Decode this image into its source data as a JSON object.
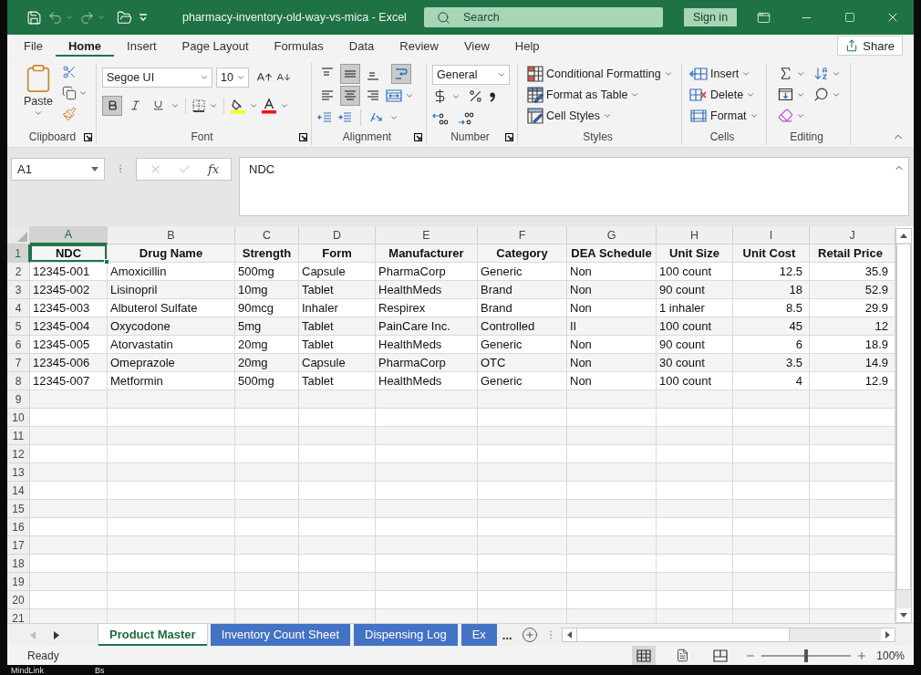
{
  "title_bar": {
    "title": "pharmacy-inventory-old-way-vs-mica - Excel",
    "search": {
      "placeholder": "Search"
    },
    "sign_in": "Sign in"
  },
  "menu_tabs": [
    {
      "label": "File",
      "selected": false
    },
    {
      "label": "Home",
      "selected": true
    },
    {
      "label": "Insert",
      "selected": false
    },
    {
      "label": "Page Layout",
      "selected": false
    },
    {
      "label": "Formulas",
      "selected": false
    },
    {
      "label": "Data",
      "selected": false
    },
    {
      "label": "Review",
      "selected": false
    },
    {
      "label": "View",
      "selected": false
    },
    {
      "label": "Help",
      "selected": false
    }
  ],
  "share_button": "Share",
  "ribbon": {
    "clipboard": {
      "label": "Clipboard",
      "paste": "Paste"
    },
    "font": {
      "label": "Font",
      "font_name": "Segoe UI",
      "font_size": "10",
      "bold": true,
      "italic": false,
      "underline": false
    },
    "alignment": {
      "label": "Alignment",
      "vertical": [
        {
          "kind": "top",
          "on": false
        },
        {
          "kind": "middle",
          "on": true
        },
        {
          "kind": "bottom",
          "on": false
        }
      ],
      "wrap_text": true,
      "horizontal": [
        {
          "kind": "left",
          "on": false
        },
        {
          "kind": "center",
          "on": true
        },
        {
          "kind": "right",
          "on": false
        }
      ]
    },
    "number": {
      "label": "Number",
      "format": "General"
    },
    "styles": {
      "label": "Styles",
      "items": [
        {
          "kind": "conditional-formatting",
          "label": "Conditional Formatting"
        },
        {
          "kind": "format-as-table",
          "label": "Format as Table"
        },
        {
          "kind": "cell-styles",
          "label": "Cell Styles"
        }
      ]
    },
    "cells": {
      "label": "Cells",
      "items": [
        {
          "kind": "insert",
          "label": "Insert"
        },
        {
          "kind": "delete",
          "label": "Delete"
        },
        {
          "kind": "format",
          "label": "Format"
        }
      ]
    },
    "editing": {
      "label": "Editing"
    }
  },
  "formula_bar": {
    "name_box": "A1",
    "function_label": "fx",
    "formula": "NDC"
  },
  "sheet": {
    "columns": [
      {
        "letter": "A",
        "selected": true,
        "kind": "text"
      },
      {
        "letter": "B",
        "selected": false,
        "kind": "text"
      },
      {
        "letter": "C",
        "selected": false,
        "kind": "text"
      },
      {
        "letter": "D",
        "selected": false,
        "kind": "text"
      },
      {
        "letter": "E",
        "selected": false,
        "kind": "text"
      },
      {
        "letter": "F",
        "selected": false,
        "kind": "text"
      },
      {
        "letter": "G",
        "selected": false,
        "kind": "text"
      },
      {
        "letter": "H",
        "selected": false,
        "kind": "text"
      },
      {
        "letter": "I",
        "selected": false,
        "kind": "number"
      },
      {
        "letter": "J",
        "selected": false,
        "kind": "number"
      }
    ],
    "rows": [
      {
        "number": "1",
        "selected": true,
        "kind": "header",
        "cells": [
          "NDC",
          "Drug Name",
          "Strength",
          "Form",
          "Manufacturer",
          "Category",
          "DEA Schedule",
          "Unit Size",
          "Unit Cost",
          "Retail Price"
        ]
      },
      {
        "number": "2",
        "selected": false,
        "kind": "data",
        "cells": [
          "12345-001",
          "Amoxicillin",
          "500mg",
          "Capsule",
          "PharmaCorp",
          "Generic",
          "Non",
          "100 count",
          "12.5",
          "35.9"
        ]
      },
      {
        "number": "3",
        "selected": false,
        "kind": "data",
        "cells": [
          "12345-002",
          "Lisinopril",
          "10mg",
          "Tablet",
          "HealthMeds",
          "Brand",
          "Non",
          "90 count",
          "18",
          "52.9"
        ]
      },
      {
        "number": "4",
        "selected": false,
        "kind": "data",
        "cells": [
          "12345-003",
          "Albuterol Sulfate",
          "90mcg",
          "Inhaler",
          "Respirex",
          "Brand",
          "Non",
          "1 inhaler",
          "8.5",
          "29.9"
        ]
      },
      {
        "number": "5",
        "selected": false,
        "kind": "data",
        "cells": [
          "12345-004",
          "Oxycodone",
          "5mg",
          "Tablet",
          "PainCare Inc.",
          "Controlled",
          "II",
          "100 count",
          "45",
          "12"
        ]
      },
      {
        "number": "6",
        "selected": false,
        "kind": "data",
        "cells": [
          "12345-005",
          "Atorvastatin",
          "20mg",
          "Tablet",
          "HealthMeds",
          "Generic",
          "Non",
          "90 count",
          "6",
          "18.9"
        ]
      },
      {
        "number": "7",
        "selected": false,
        "kind": "data",
        "cells": [
          "12345-006",
          "Omeprazole",
          "20mg",
          "Capsule",
          "PharmaCorp",
          "OTC",
          "Non",
          "30 count",
          "3.5",
          "14.9"
        ]
      },
      {
        "number": "8",
        "selected": false,
        "kind": "data",
        "cells": [
          "12345-007",
          "Metformin",
          "500mg",
          "Tablet",
          "HealthMeds",
          "Generic",
          "Non",
          "100 count",
          "4",
          "12.9"
        ]
      },
      {
        "number": "9",
        "selected": false
      },
      {
        "number": "10",
        "selected": false
      },
      {
        "number": "11",
        "selected": false
      },
      {
        "number": "12",
        "selected": false
      },
      {
        "number": "13",
        "selected": false
      },
      {
        "number": "14",
        "selected": false
      },
      {
        "number": "15",
        "selected": false
      },
      {
        "number": "16",
        "selected": false
      },
      {
        "number": "17",
        "selected": false
      },
      {
        "number": "18",
        "selected": false
      },
      {
        "number": "19",
        "selected": false
      },
      {
        "number": "20",
        "selected": false
      },
      {
        "number": "21",
        "selected": false
      }
    ]
  },
  "sheet_tabs": [
    {
      "label": "Product Master",
      "selected": true
    },
    {
      "label": "Inventory Count Sheet",
      "selected": false
    },
    {
      "label": "Dispensing Log",
      "selected": false
    },
    {
      "label": "Ex",
      "selected": false
    }
  ],
  "more_tabs": "...",
  "status_bar": {
    "status": "Ready",
    "views": [
      {
        "kind": "normal",
        "selected": true
      },
      {
        "kind": "page-layout",
        "selected": false
      },
      {
        "kind": "page-break",
        "selected": false
      }
    ],
    "zoom": {
      "level": 0.5,
      "label": "100%"
    }
  },
  "desktop_labels": [
    "MindLink",
    "Bs"
  ]
}
